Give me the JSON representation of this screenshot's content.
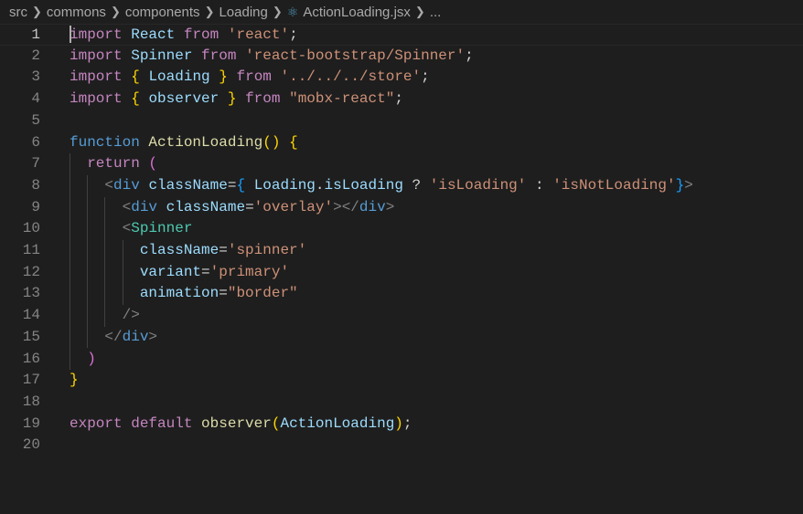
{
  "breadcrumb": {
    "items": [
      "src",
      "commons",
      "components",
      "Loading",
      "ActionLoading.jsx",
      "..."
    ],
    "file_icon": "react-icon"
  },
  "colors": {
    "background": "#1e1e1e",
    "keyword": "#c586c0",
    "variable": "#9cdcfe",
    "string": "#ce9178",
    "function": "#dcdcaa",
    "tag": "#569cd6",
    "component": "#4ec9b0"
  },
  "editor": {
    "current_line": 1,
    "lines": [
      {
        "n": "1",
        "indent": 0,
        "tokens": [
          [
            "import",
            "kw"
          ],
          [
            " ",
            "plain"
          ],
          [
            "React",
            "var"
          ],
          [
            " ",
            "plain"
          ],
          [
            "from",
            "kw"
          ],
          [
            " ",
            "plain"
          ],
          [
            "'react'",
            "str"
          ],
          [
            ";",
            "plain"
          ]
        ]
      },
      {
        "n": "2",
        "indent": 0,
        "tokens": [
          [
            "import",
            "kw"
          ],
          [
            " ",
            "plain"
          ],
          [
            "Spinner",
            "var"
          ],
          [
            " ",
            "plain"
          ],
          [
            "from",
            "kw"
          ],
          [
            " ",
            "plain"
          ],
          [
            "'react-bootstrap/Spinner'",
            "str"
          ],
          [
            ";",
            "plain"
          ]
        ]
      },
      {
        "n": "3",
        "indent": 0,
        "tokens": [
          [
            "import",
            "kw"
          ],
          [
            " ",
            "plain"
          ],
          [
            "{",
            "b1"
          ],
          [
            " ",
            "plain"
          ],
          [
            "Loading",
            "var"
          ],
          [
            " ",
            "plain"
          ],
          [
            "}",
            "b1"
          ],
          [
            " ",
            "plain"
          ],
          [
            "from",
            "kw"
          ],
          [
            " ",
            "plain"
          ],
          [
            "'../../../store'",
            "str"
          ],
          [
            ";",
            "plain"
          ]
        ]
      },
      {
        "n": "4",
        "indent": 0,
        "tokens": [
          [
            "import",
            "kw"
          ],
          [
            " ",
            "plain"
          ],
          [
            "{",
            "b1"
          ],
          [
            " ",
            "plain"
          ],
          [
            "observer",
            "var"
          ],
          [
            " ",
            "plain"
          ],
          [
            "}",
            "b1"
          ],
          [
            " ",
            "plain"
          ],
          [
            "from",
            "kw"
          ],
          [
            " ",
            "plain"
          ],
          [
            "\"mobx-react\"",
            "str"
          ],
          [
            ";",
            "plain"
          ]
        ]
      },
      {
        "n": "5",
        "indent": 0,
        "tokens": []
      },
      {
        "n": "6",
        "indent": 0,
        "tokens": [
          [
            "function",
            "storage"
          ],
          [
            " ",
            "plain"
          ],
          [
            "ActionLoading",
            "fn"
          ],
          [
            "()",
            "b1"
          ],
          [
            " ",
            "plain"
          ],
          [
            "{",
            "b1"
          ]
        ]
      },
      {
        "n": "7",
        "indent": 1,
        "tokens": [
          [
            "  ",
            "plain"
          ],
          [
            "return",
            "kw"
          ],
          [
            " ",
            "plain"
          ],
          [
            "(",
            "b2"
          ]
        ]
      },
      {
        "n": "8",
        "indent": 2,
        "tokens": [
          [
            "    ",
            "plain"
          ],
          [
            "<",
            "punct"
          ],
          [
            "div",
            "tag"
          ],
          [
            " ",
            "plain"
          ],
          [
            "className",
            "var"
          ],
          [
            "=",
            "plain"
          ],
          [
            "{",
            "b3"
          ],
          [
            " ",
            "plain"
          ],
          [
            "Loading",
            "var"
          ],
          [
            ".",
            "plain"
          ],
          [
            "isLoading",
            "var"
          ],
          [
            " ? ",
            "plain"
          ],
          [
            "'isLoading'",
            "str"
          ],
          [
            " : ",
            "plain"
          ],
          [
            "'isNotLoading'",
            "str"
          ],
          [
            "}",
            "b3"
          ],
          [
            ">",
            "punct"
          ]
        ]
      },
      {
        "n": "9",
        "indent": 3,
        "tokens": [
          [
            "      ",
            "plain"
          ],
          [
            "<",
            "punct"
          ],
          [
            "div",
            "tag"
          ],
          [
            " ",
            "plain"
          ],
          [
            "className",
            "var"
          ],
          [
            "=",
            "plain"
          ],
          [
            "'overlay'",
            "str"
          ],
          [
            "></",
            "punct"
          ],
          [
            "div",
            "tag"
          ],
          [
            ">",
            "punct"
          ]
        ]
      },
      {
        "n": "10",
        "indent": 3,
        "tokens": [
          [
            "      ",
            "plain"
          ],
          [
            "<",
            "punct"
          ],
          [
            "Spinner",
            "comp"
          ]
        ]
      },
      {
        "n": "11",
        "indent": 4,
        "tokens": [
          [
            "        ",
            "plain"
          ],
          [
            "className",
            "var"
          ],
          [
            "=",
            "plain"
          ],
          [
            "'spinner'",
            "str"
          ]
        ]
      },
      {
        "n": "12",
        "indent": 4,
        "tokens": [
          [
            "        ",
            "plain"
          ],
          [
            "variant",
            "var"
          ],
          [
            "=",
            "plain"
          ],
          [
            "'primary'",
            "str"
          ]
        ]
      },
      {
        "n": "13",
        "indent": 4,
        "tokens": [
          [
            "        ",
            "plain"
          ],
          [
            "animation",
            "var"
          ],
          [
            "=",
            "plain"
          ],
          [
            "\"border\"",
            "str"
          ]
        ]
      },
      {
        "n": "14",
        "indent": 3,
        "tokens": [
          [
            "      ",
            "plain"
          ],
          [
            "/>",
            "punct"
          ]
        ]
      },
      {
        "n": "15",
        "indent": 2,
        "tokens": [
          [
            "    ",
            "plain"
          ],
          [
            "</",
            "punct"
          ],
          [
            "div",
            "tag"
          ],
          [
            ">",
            "punct"
          ]
        ]
      },
      {
        "n": "16",
        "indent": 1,
        "tokens": [
          [
            "  ",
            "plain"
          ],
          [
            ")",
            "b2"
          ]
        ]
      },
      {
        "n": "17",
        "indent": 0,
        "tokens": [
          [
            "}",
            "b1"
          ]
        ]
      },
      {
        "n": "18",
        "indent": 0,
        "tokens": []
      },
      {
        "n": "19",
        "indent": 0,
        "tokens": [
          [
            "export",
            "kw"
          ],
          [
            " ",
            "plain"
          ],
          [
            "default",
            "kw"
          ],
          [
            " ",
            "plain"
          ],
          [
            "observer",
            "fn"
          ],
          [
            "(",
            "b1"
          ],
          [
            "ActionLoading",
            "var"
          ],
          [
            ")",
            "b1"
          ],
          [
            ";",
            "plain"
          ]
        ]
      },
      {
        "n": "20",
        "indent": 0,
        "tokens": []
      }
    ]
  }
}
